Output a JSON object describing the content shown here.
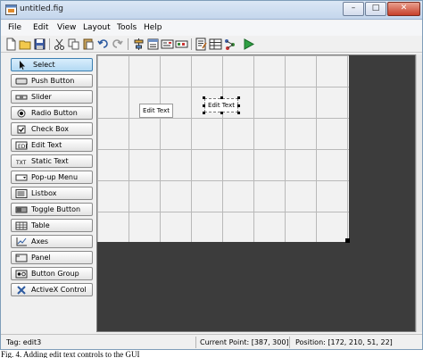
{
  "window": {
    "title": "untitled.fig",
    "min_glyph": "–",
    "max_glyph": "□",
    "close_glyph": "✕"
  },
  "menu": [
    "File",
    "Edit",
    "View",
    "Layout",
    "Tools",
    "Help"
  ],
  "toolbar": {
    "icons": [
      "new-file-icon",
      "open-folder-icon",
      "save-icon",
      "cut-icon",
      "copy-icon",
      "paste-icon",
      "undo-icon",
      "redo-icon",
      "align-objects-icon",
      "menu-editor-icon",
      "tab-order-editor-icon",
      "toolbar-editor-icon",
      "m-file-editor-icon",
      "property-inspector-icon",
      "object-browser-icon",
      "run-figure-icon"
    ]
  },
  "palette": [
    {
      "label": "Select",
      "icon": "arrow-cursor-icon",
      "selected": true
    },
    {
      "label": "Push Button",
      "icon": "push-button-icon"
    },
    {
      "label": "Slider",
      "icon": "slider-icon"
    },
    {
      "label": "Radio Button",
      "icon": "radio-button-icon"
    },
    {
      "label": "Check Box",
      "icon": "check-box-icon"
    },
    {
      "label": "Edit Text",
      "icon": "edit-text-icon"
    },
    {
      "label": "Static Text",
      "icon": "static-text-icon"
    },
    {
      "label": "Pop-up Menu",
      "icon": "popup-menu-icon"
    },
    {
      "label": "Listbox",
      "icon": "listbox-icon"
    },
    {
      "label": "Toggle Button",
      "icon": "toggle-button-icon"
    },
    {
      "label": "Table",
      "icon": "table-icon"
    },
    {
      "label": "Axes",
      "icon": "axes-icon"
    },
    {
      "label": "Panel",
      "icon": "panel-icon"
    },
    {
      "label": "Button Group",
      "icon": "button-group-icon"
    },
    {
      "label": "ActiveX Control",
      "icon": "activex-icon"
    }
  ],
  "canvas": {
    "controls": [
      {
        "type": "edit text",
        "label": "Edit Text",
        "selected": false
      },
      {
        "type": "edit text",
        "label": "Edit Text",
        "selected": true
      }
    ]
  },
  "status": {
    "tag": "Tag: edit3",
    "current_point": "Current Point:  [387, 300]",
    "position": "Position: [172, 210, 51, 22]"
  },
  "caption": "Fig. 4. Adding edit text controls to the GUI",
  "colors": {
    "accent": "#3c7fb1",
    "canvas_bg": "#3c3c3c",
    "grid_bg": "#f2f2f2",
    "close": "#c7402a"
  }
}
